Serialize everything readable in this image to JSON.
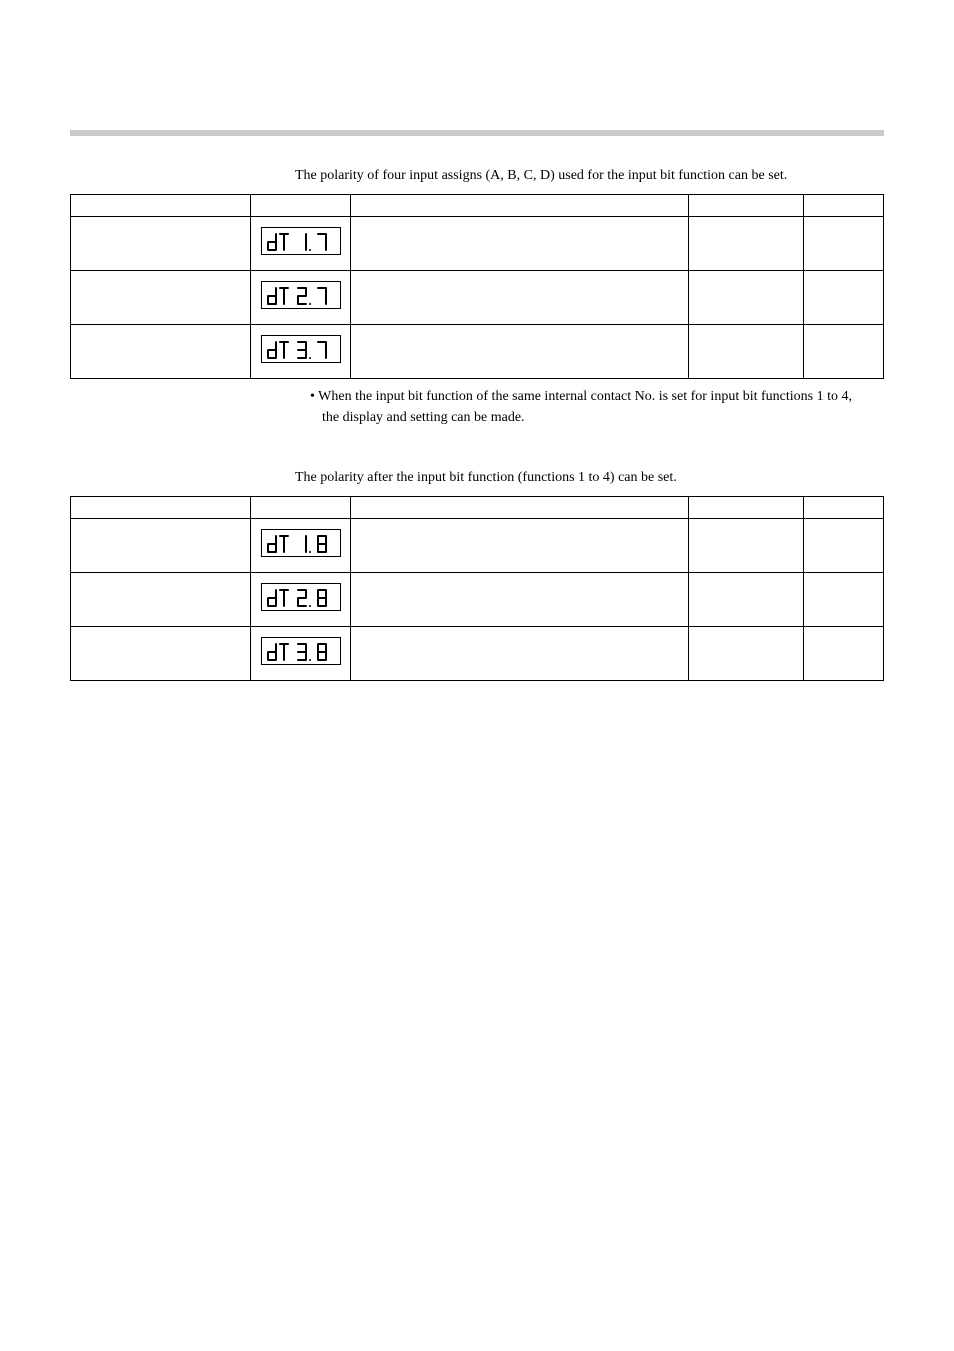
{
  "section1": {
    "intro": "The polarity of four input assigns (A, B, C, D) used for the input bit function can be set.",
    "note": "• When the input bit function of the same internal contact No. is set for input bit functions 1 to 4, the display and setting can be made."
  },
  "section2": {
    "intro": "The polarity after the input bit function (functions 1 to 4) can be set."
  },
  "displays": {
    "d1_17": "di 1.7",
    "d1_27": "di 2.7",
    "d1_37": "di 3.7",
    "d1_18": "di 1.8",
    "d1_28": "di 2.8",
    "d1_38": "di 3.8"
  }
}
